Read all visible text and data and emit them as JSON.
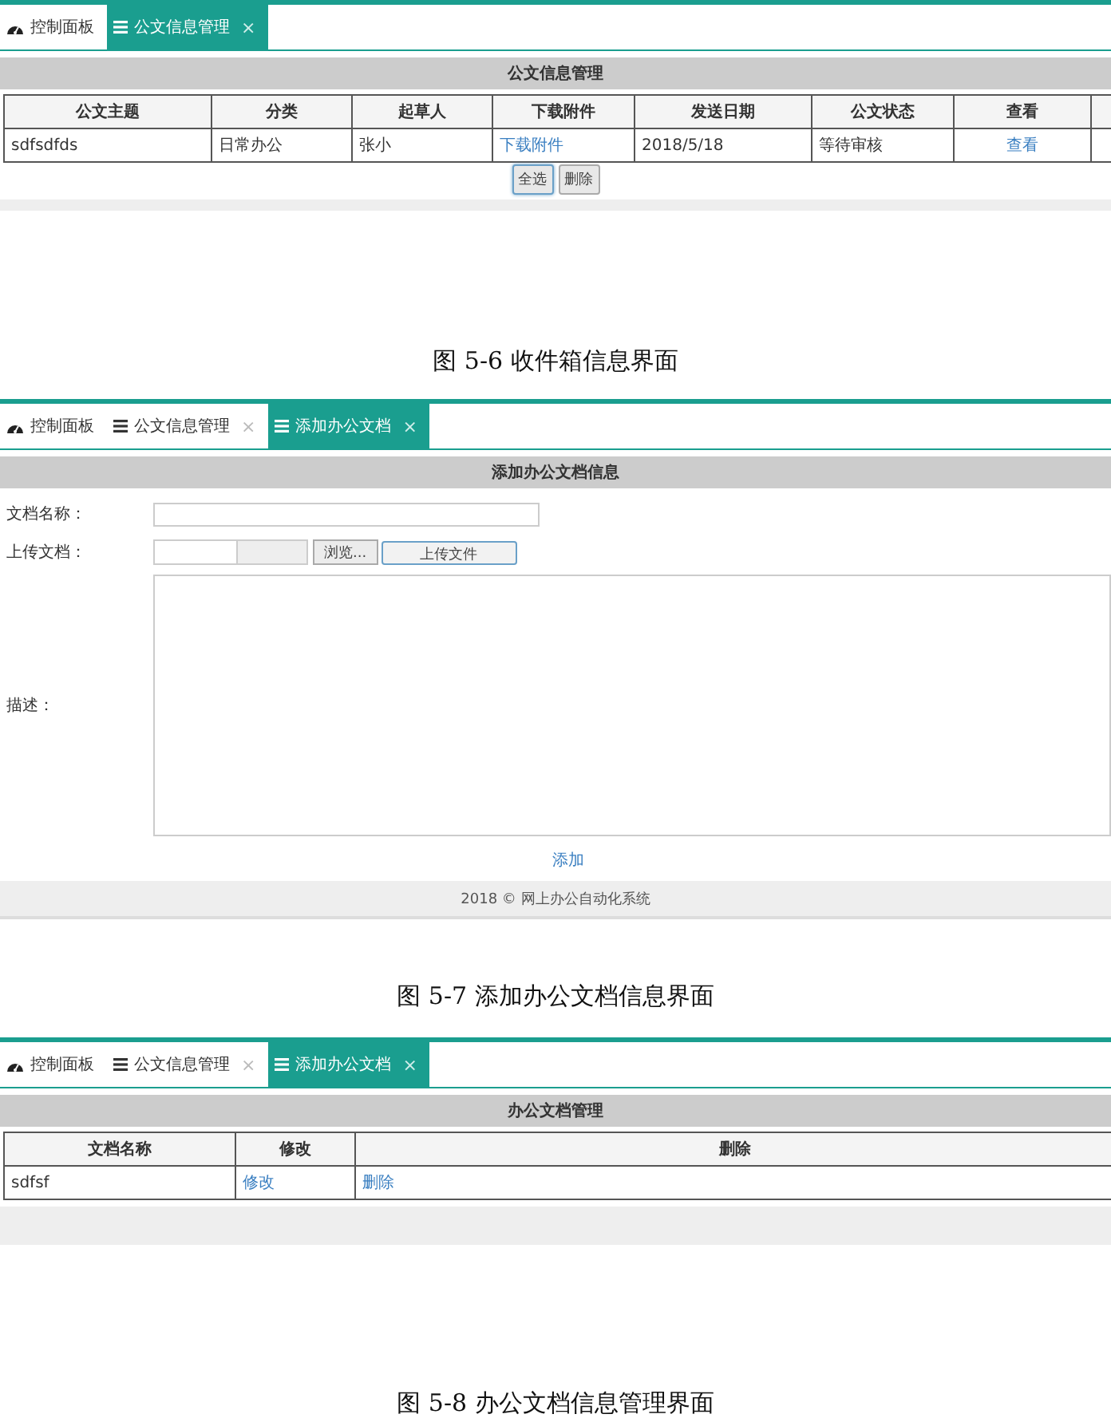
{
  "figures": [
    {
      "kind": "list",
      "tabs": [
        {
          "kind": "dashboard",
          "label": "控制面板",
          "selected": false
        },
        {
          "kind": "page",
          "label": "公文信息管理",
          "close": "×",
          "selected": true
        }
      ],
      "panel_title": "公文信息管理",
      "columns": [
        "公文主题",
        "分类",
        "起草人",
        "下载附件",
        "发送日期",
        "公文状态",
        "查看"
      ],
      "cut_column": true,
      "rows": [
        [
          {
            "kind": "text",
            "text": "sdfsdfds"
          },
          {
            "kind": "text",
            "text": "日常办公"
          },
          {
            "kind": "text",
            "text": "张小"
          },
          {
            "kind": "link",
            "text": "下载附件"
          },
          {
            "kind": "text",
            "text": "2018/5/18"
          },
          {
            "kind": "text",
            "text": "等待审核"
          },
          {
            "kind": "link",
            "text": "查看"
          }
        ]
      ],
      "buttons": [
        {
          "label": "全选",
          "focused": true
        },
        {
          "label": "删除",
          "focused": false
        }
      ],
      "caption": "图 5-6 收件箱信息界面"
    },
    {
      "kind": "form",
      "tabs": [
        {
          "kind": "dashboard",
          "label": "控制面板",
          "selected": false
        },
        {
          "kind": "page",
          "label": "公文信息管理",
          "close": "×",
          "selected": false
        },
        {
          "kind": "page",
          "label": "添加办公文档",
          "close": "×",
          "selected": true
        }
      ],
      "panel_title": "添加办公文档信息",
      "fields": [
        {
          "kind": "text",
          "label": "文档名称："
        },
        {
          "kind": "file",
          "label": "上传文档：",
          "browse": "浏览...",
          "upload": "上传文件"
        },
        {
          "kind": "textarea",
          "label": "描述："
        }
      ],
      "submit": "添加",
      "footer": "2018 © 网上办公自动化系统",
      "caption": "图 5-7 添加办公文档信息界面"
    },
    {
      "kind": "list",
      "tabs": [
        {
          "kind": "dashboard",
          "label": "控制面板",
          "selected": false
        },
        {
          "kind": "page",
          "label": "公文信息管理",
          "close": "×",
          "selected": false
        },
        {
          "kind": "page",
          "label": "添加办公文档",
          "close": "×",
          "selected": true
        }
      ],
      "panel_title": "办公文档管理",
      "columns": [
        "文档名称",
        "修改",
        "删除"
      ],
      "rows": [
        [
          {
            "kind": "text",
            "text": "sdfsf"
          },
          {
            "kind": "link",
            "text": "修改"
          },
          {
            "kind": "link",
            "text": "删除"
          }
        ]
      ],
      "caption": "图 5-8 办公文档信息管理界面"
    }
  ]
}
